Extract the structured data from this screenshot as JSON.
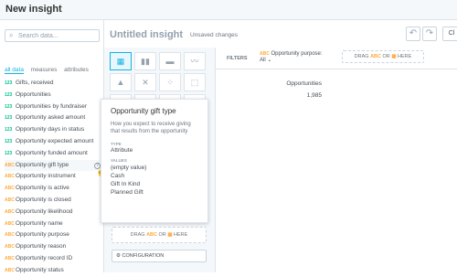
{
  "app": {
    "title": "New insight"
  },
  "search": {
    "placeholder": "Search data..."
  },
  "filters": {
    "all": "all data",
    "measures": "measures",
    "attributes": "attributes"
  },
  "items": [
    {
      "tag": "123",
      "type": "measure",
      "label": "Gifts, received"
    },
    {
      "tag": "123",
      "type": "measure",
      "label": "Opportunities"
    },
    {
      "tag": "123",
      "type": "measure",
      "label": "Opportunities by fundraiser"
    },
    {
      "tag": "123",
      "type": "measure",
      "label": "Opportunity asked amount"
    },
    {
      "tag": "123",
      "type": "measure",
      "label": "Opportunity days in status"
    },
    {
      "tag": "123",
      "type": "measure",
      "label": "Opportunity expected amount"
    },
    {
      "tag": "123",
      "type": "measure",
      "label": "Opportunity funded amount"
    },
    {
      "tag": "ABC",
      "type": "attribute",
      "label": "Opportunity gift type"
    },
    {
      "tag": "ABC",
      "type": "attribute",
      "label": "Opportunity instrument"
    },
    {
      "tag": "ABC",
      "type": "attribute",
      "label": "Opportunity is active"
    },
    {
      "tag": "ABC",
      "type": "attribute",
      "label": "Opportunity is closed"
    },
    {
      "tag": "ABC",
      "type": "attribute",
      "label": "Opportunity likelihood"
    },
    {
      "tag": "ABC",
      "type": "attribute",
      "label": "Opportunity name"
    },
    {
      "tag": "ABC",
      "type": "attribute",
      "label": "Opportunity purpose"
    },
    {
      "tag": "ABC",
      "type": "attribute",
      "label": "Opportunity reason"
    },
    {
      "tag": "ABC",
      "type": "attribute",
      "label": "Opportunity record ID"
    },
    {
      "tag": "ABC",
      "type": "attribute",
      "label": "Opportunity status"
    }
  ],
  "help_glyph": "?",
  "insight": {
    "title": "Untitled insight",
    "status": "Unsaved changes",
    "undo_glyph": "↶",
    "redo_glyph": "↷",
    "close_label": "Cl"
  },
  "viz_icons": [
    "▦",
    "▮▮",
    "▬",
    "〰",
    "▲",
    "✕",
    "⁘",
    "⬚",
    "⬚",
    "⬚",
    "⬚",
    "⬚"
  ],
  "drag": {
    "label": "DRAG",
    "abc": "ABC",
    "or": "OR",
    "here": "HERE"
  },
  "config": {
    "icon": "⚙",
    "label": "CONFIGURATION"
  },
  "filter_bar": {
    "label": "FILTERS",
    "chip_abc": "ABC",
    "chip_name": "Opportunity purpose:",
    "chip_value": "All",
    "chip_caret": "⌄"
  },
  "table": {
    "header": "Opportunities",
    "value": "1,985"
  },
  "tooltip": {
    "title": "Opportunity gift type",
    "description": "How you expect to receive giving that results from the opportunity",
    "type_label": "TYPE",
    "type_value": "Attribute",
    "values_label": "VALUES",
    "values": [
      "(empty value)",
      "Cash",
      "Gift In Kind",
      "Planned Gift"
    ]
  },
  "colors": {
    "accent": "#14b2e2",
    "measure": "#00c18d",
    "attribute": "#fdaa3a"
  }
}
